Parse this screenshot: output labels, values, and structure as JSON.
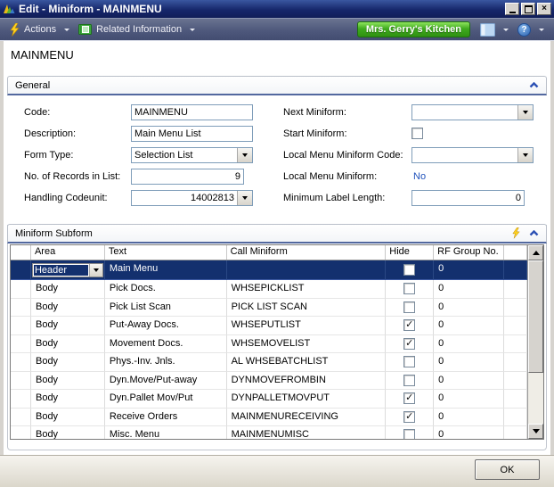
{
  "window": {
    "title": "Edit - Miniform - MAINMENU"
  },
  "toolbar": {
    "actions_label": "Actions",
    "related_label": "Related Information",
    "company_label": "Mrs. Gerry's Kitchen"
  },
  "page": {
    "title": "MAINMENU"
  },
  "general": {
    "title": "General",
    "left_fields": [
      {
        "label": "Code:",
        "value": "MAINMENU",
        "type": "text"
      },
      {
        "label": "Description:",
        "value": "Main Menu List",
        "type": "text"
      },
      {
        "label": "Form Type:",
        "value": "Selection List",
        "type": "combo"
      },
      {
        "label": "No. of Records in List:",
        "value": "9",
        "type": "number"
      },
      {
        "label": "Handling Codeunit:",
        "value": "14002813",
        "type": "number-combo"
      }
    ],
    "right_fields": [
      {
        "label": "Next Miniform:",
        "value": "",
        "type": "combo"
      },
      {
        "label": "Start Miniform:",
        "checked": false,
        "type": "checkbox"
      },
      {
        "label": "Local Menu Miniform Code:",
        "value": "",
        "type": "combo"
      },
      {
        "label": "Local Menu Miniform:",
        "value": "No",
        "type": "readonly"
      },
      {
        "label": "Minimum Label Length:",
        "value": "0",
        "type": "number"
      }
    ]
  },
  "subform": {
    "title": "Miniform Subform",
    "columns": [
      "Area",
      "Text",
      "Call Miniform",
      "Hide",
      "RF Group No."
    ],
    "rows": [
      {
        "area": "Header",
        "text": "Main Menu",
        "call": "",
        "hide": false,
        "rf": "0",
        "selected": true
      },
      {
        "area": "Body",
        "text": "Pick Docs.",
        "call": "WHSEPICKLIST",
        "hide": false,
        "rf": "0"
      },
      {
        "area": "Body",
        "text": "Pick List Scan",
        "call": "PICK LIST SCAN",
        "hide": false,
        "rf": "0"
      },
      {
        "area": "Body",
        "text": "Put-Away Docs.",
        "call": "WHSEPUTLIST",
        "hide": true,
        "rf": "0"
      },
      {
        "area": "Body",
        "text": "Movement Docs.",
        "call": "WHSEMOVELIST",
        "hide": true,
        "rf": "0"
      },
      {
        "area": "Body",
        "text": "Phys.-Inv. Jnls.",
        "call": "AL WHSEBATCHLIST",
        "hide": false,
        "rf": "0"
      },
      {
        "area": "Body",
        "text": "Dyn.Move/Put-away",
        "call": "DYNMOVEFROMBIN",
        "hide": false,
        "rf": "0"
      },
      {
        "area": "Body",
        "text": "Dyn.Pallet Mov/Put",
        "call": "DYNPALLETMOVPUT",
        "hide": true,
        "rf": "0"
      },
      {
        "area": "Body",
        "text": "Receive Orders",
        "call": "MAINMENURECEIVING",
        "hide": true,
        "rf": "0"
      },
      {
        "area": "Body",
        "text": "Misc. Menu",
        "call": "MAINMENUMISC",
        "hide": false,
        "rf": "0"
      }
    ]
  },
  "footer": {
    "ok_label": "OK"
  },
  "colors": {
    "titlebar": "#16276B",
    "toolbar": "#4E587C",
    "selection_row": "#13306E",
    "company_green": "#3FAA1E",
    "link_blue": "#1F51BB",
    "input_border": "#7F9DB9",
    "section_rule": "#52689F",
    "check_glyph": "✓"
  }
}
